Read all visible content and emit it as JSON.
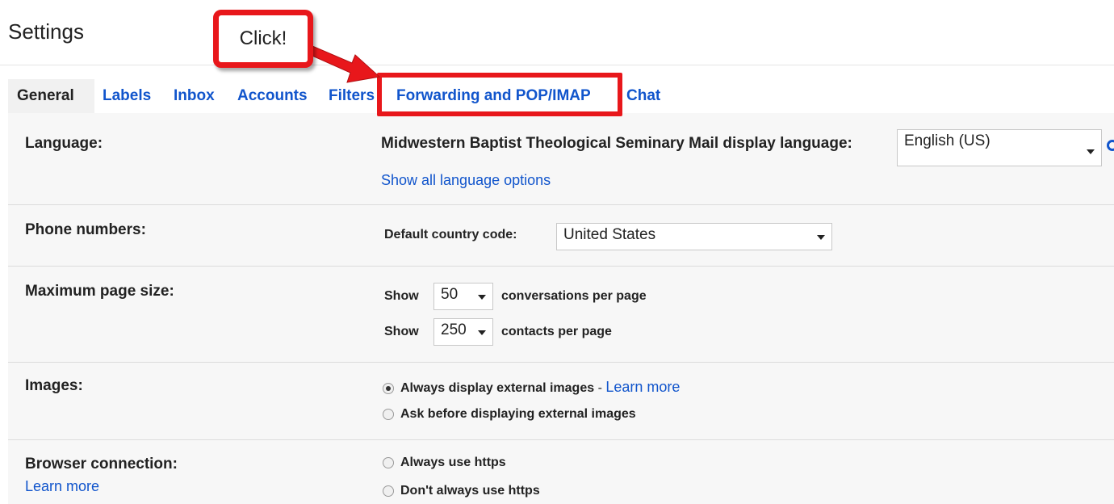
{
  "page": {
    "title": "Settings"
  },
  "callout": {
    "text": "Click!"
  },
  "tabs": [
    {
      "label": "General",
      "active": true
    },
    {
      "label": "Labels",
      "active": false
    },
    {
      "label": "Inbox",
      "active": false
    },
    {
      "label": "Accounts",
      "active": false
    },
    {
      "label": "Filters",
      "active": false
    },
    {
      "label": "Forwarding and POP/IMAP",
      "active": false,
      "highlighted": true
    },
    {
      "label": "Chat",
      "active": false
    }
  ],
  "language": {
    "label": "Language:",
    "display_label": "Midwestern Baptist Theological Seminary Mail display language:",
    "selected": "English (US)",
    "show_all_link": "Show all language options"
  },
  "phone": {
    "label": "Phone numbers:",
    "country_label": "Default country code:",
    "selected": "United States"
  },
  "page_size": {
    "label": "Maximum page size:",
    "show1": "Show",
    "conversations_value": "50",
    "conversations_suffix": "conversations per page",
    "show2": "Show",
    "contacts_value": "250",
    "contacts_suffix": "contacts per page"
  },
  "images": {
    "label": "Images:",
    "option1": "Always display external images",
    "separator": "-",
    "learn_more": "Learn more",
    "option2": "Ask before displaying external images",
    "selected_option": 1
  },
  "browser": {
    "label": "Browser connection:",
    "learn_more": "Learn more",
    "option1": "Always use https",
    "option2": "Don't always use https"
  },
  "colors": {
    "link": "#1155cc",
    "highlight": "#e8171b",
    "panel_bg": "#f7f7f7"
  }
}
